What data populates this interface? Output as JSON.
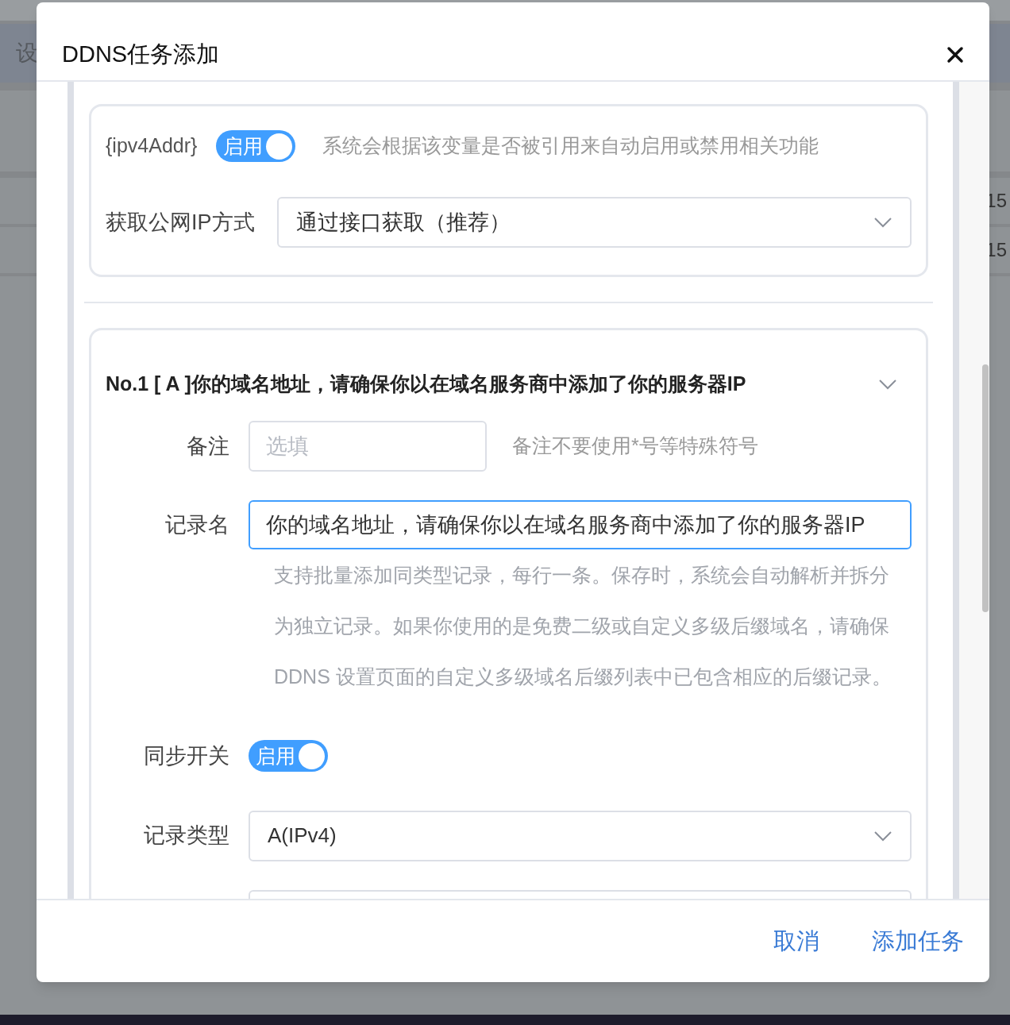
{
  "background": {
    "heading": "设",
    "cells": [
      "15",
      "15"
    ]
  },
  "dialog": {
    "title": "DDNS任务添加",
    "ipv4_section": {
      "variable": "{ipv4Addr}",
      "switch": {
        "label": "启用",
        "on": true
      },
      "hint": "系统会根据该变量是否被引用来自动启用或禁用相关功能",
      "method_label": "获取公网IP方式",
      "method_value": "通过接口获取（推荐）"
    },
    "record": {
      "title": "No.1 [ A ]你的域名地址，请确保你以在域名服务商中添加了你的服务器IP",
      "expanded": true,
      "remark": {
        "label": "备注",
        "placeholder": "选填",
        "hint": "备注不要使用*号等特殊符号"
      },
      "record_name": {
        "label": "记录名",
        "value": "你的域名地址，请确保你以在域名服务商中添加了你的服务器IP",
        "help": "支持批量添加同类型记录，每行一条。保存时，系统会自动解析并拆分为独立记录。如果你使用的是免费二级或自定义多级后缀域名，请确保 DDNS 设置页面的自定义多级域名后缀列表中已包含相应的后缀记录。"
      },
      "sync": {
        "label": "同步开关",
        "switch_label": "启用",
        "on": true
      },
      "record_type": {
        "label": "记录类型",
        "value": "A(IPv4)"
      }
    },
    "buttons": [
      {
        "label": "取消"
      },
      {
        "label": "添加任务"
      }
    ]
  }
}
